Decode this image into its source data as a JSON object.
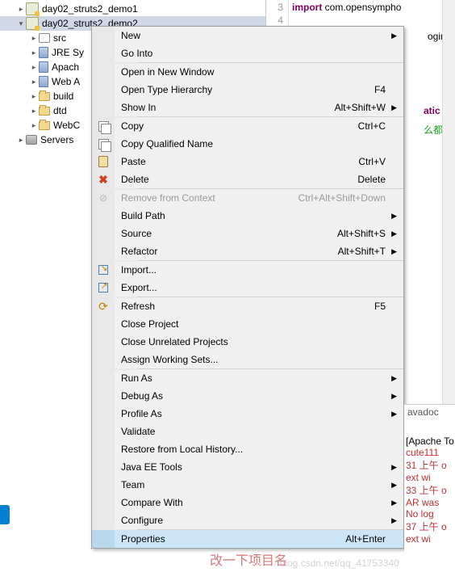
{
  "tree": {
    "items": [
      {
        "label": "day02_struts2_demo1",
        "depth": 1,
        "icon": "proj",
        "twisty": ">"
      },
      {
        "label": "day02_struts2_demo2",
        "depth": 1,
        "icon": "proj",
        "twisty": "v",
        "selected": true
      },
      {
        "label": "src",
        "depth": 2,
        "icon": "pkg",
        "twisty": ">"
      },
      {
        "label": "JRE Sy",
        "depth": 2,
        "icon": "lib",
        "twisty": ">"
      },
      {
        "label": "Apach",
        "depth": 2,
        "icon": "lib",
        "twisty": ">"
      },
      {
        "label": "Web A",
        "depth": 2,
        "icon": "lib",
        "twisty": ">"
      },
      {
        "label": "build",
        "depth": 2,
        "icon": "folder",
        "twisty": ">"
      },
      {
        "label": "dtd",
        "depth": 2,
        "icon": "folder",
        "twisty": ">"
      },
      {
        "label": "WebC",
        "depth": 2,
        "icon": "folder",
        "twisty": ">"
      },
      {
        "label": "Servers",
        "depth": 1,
        "icon": "server",
        "twisty": ">"
      }
    ]
  },
  "editor": {
    "line3_num": "3",
    "line3_kw": "import",
    "line3_pkg": " com.opensympho",
    "line4_num": "4",
    "frag_loginAct": "oginAct",
    "frag_static": "atic fi",
    "frag_comment": "么都不用写"
  },
  "menu": {
    "items": [
      {
        "label": "New",
        "arrow": true
      },
      {
        "label": "Go Into"
      },
      {
        "sep": true
      },
      {
        "label": "Open in New Window"
      },
      {
        "label": "Open Type Hierarchy",
        "shortcut": "F4"
      },
      {
        "label": "Show In",
        "shortcut": "Alt+Shift+W",
        "arrow": true
      },
      {
        "sep": true
      },
      {
        "label": "Copy",
        "shortcut": "Ctrl+C",
        "icon": "copy"
      },
      {
        "label": "Copy Qualified Name",
        "icon": "copy"
      },
      {
        "label": "Paste",
        "shortcut": "Ctrl+V",
        "icon": "paste"
      },
      {
        "label": "Delete",
        "shortcut": "Delete",
        "icon": "delete"
      },
      {
        "sep": true
      },
      {
        "label": "Remove from Context",
        "shortcut": "Ctrl+Alt+Shift+Down",
        "icon": "remove",
        "disabled": true
      },
      {
        "label": "Build Path",
        "arrow": true
      },
      {
        "label": "Source",
        "shortcut": "Alt+Shift+S",
        "arrow": true
      },
      {
        "label": "Refactor",
        "shortcut": "Alt+Shift+T",
        "arrow": true
      },
      {
        "sep": true
      },
      {
        "label": "Import...",
        "icon": "import"
      },
      {
        "label": "Export...",
        "icon": "export"
      },
      {
        "sep": true
      },
      {
        "label": "Refresh",
        "shortcut": "F5",
        "icon": "refresh"
      },
      {
        "label": "Close Project"
      },
      {
        "label": "Close Unrelated Projects"
      },
      {
        "label": "Assign Working Sets..."
      },
      {
        "sep": true
      },
      {
        "label": "Run As",
        "arrow": true
      },
      {
        "label": "Debug As",
        "arrow": true
      },
      {
        "label": "Profile As",
        "arrow": true
      },
      {
        "label": "Validate"
      },
      {
        "label": "Restore from Local History..."
      },
      {
        "label": "Java EE Tools",
        "arrow": true
      },
      {
        "label": "Team",
        "arrow": true
      },
      {
        "label": "Compare With",
        "arrow": true
      },
      {
        "label": "Configure",
        "arrow": true
      },
      {
        "sep": true
      },
      {
        "label": "Properties",
        "shortcut": "Alt+Enter",
        "highlighted": true
      }
    ]
  },
  "console": {
    "tab": "avadoc",
    "lines": [
      {
        "text": "[Apache To",
        "cls": "black"
      },
      {
        "text": "cute111",
        "cls": "red"
      },
      {
        "text": "31 上午 o",
        "cls": "red"
      },
      {
        "text": "ext wi",
        "cls": "red"
      },
      {
        "text": "33 上午 o",
        "cls": "red"
      },
      {
        "text": "AR was",
        "cls": "red"
      },
      {
        "text": " No log",
        "cls": "red"
      },
      {
        "text": "37 上午 o",
        "cls": "red"
      },
      {
        "text": "ext wi",
        "cls": "red"
      }
    ]
  },
  "watermark": "改一下项目名",
  "watermark_url": "//blog.csdn.net/qq_41753340"
}
